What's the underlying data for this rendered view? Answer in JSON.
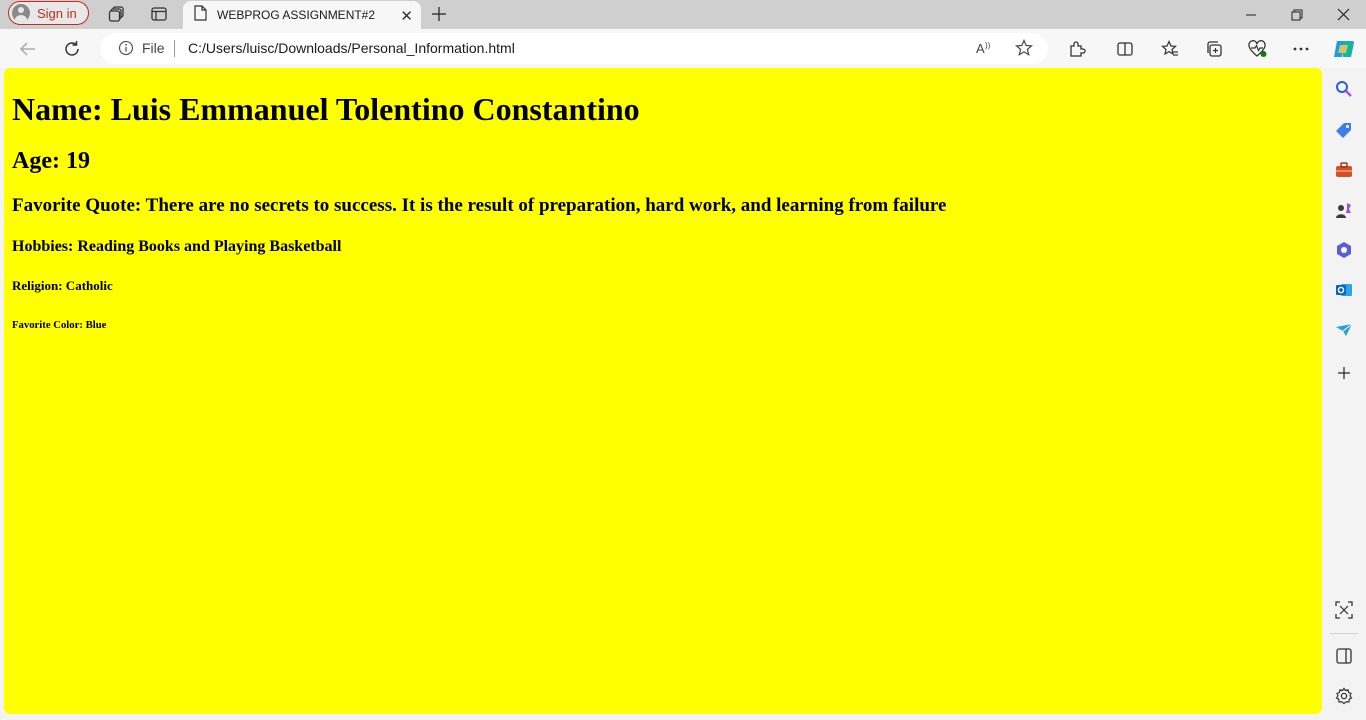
{
  "browser": {
    "signin_label": "Sign in",
    "tab_title": "WEBPROG ASSIGNMENT#2",
    "address_scheme_label": "File",
    "address_url": "C:/Users/luisc/Downloads/Personal_Information.html"
  },
  "page": {
    "background_color": "#ffff00",
    "name_heading": "Name: Luis Emmanuel Tolentino Constantino",
    "age_heading": "Age: 19",
    "quote_heading": "Favorite Quote: There are no secrets to success. It is the result of preparation, hard work, and learning from failure",
    "hobbies_heading": "Hobbies: Reading Books and Playing Basketball",
    "religion_heading": "Religion: Catholic",
    "color_heading": "Favorite Color: Blue"
  },
  "icons": {
    "titlebar": [
      "workspaces-icon",
      "tab-actions-icon",
      "new-tab-icon",
      "minimize-icon",
      "restore-icon",
      "close-icon"
    ],
    "toolbar": [
      "back-icon",
      "refresh-icon",
      "info-icon",
      "read-aloud-icon",
      "favorite-star-icon",
      "extensions-icon",
      "split-screen-icon",
      "favorites-icon",
      "collections-icon",
      "browser-essentials-icon",
      "more-icon",
      "copilot-icon"
    ],
    "sidebar": [
      "search-icon",
      "shopping-icon",
      "tools-icon",
      "games-icon",
      "microsoft365-icon",
      "outlook-icon",
      "drop-icon",
      "add-icon",
      "screenshot-icon",
      "sidebar-toggle-icon",
      "settings-icon"
    ]
  }
}
